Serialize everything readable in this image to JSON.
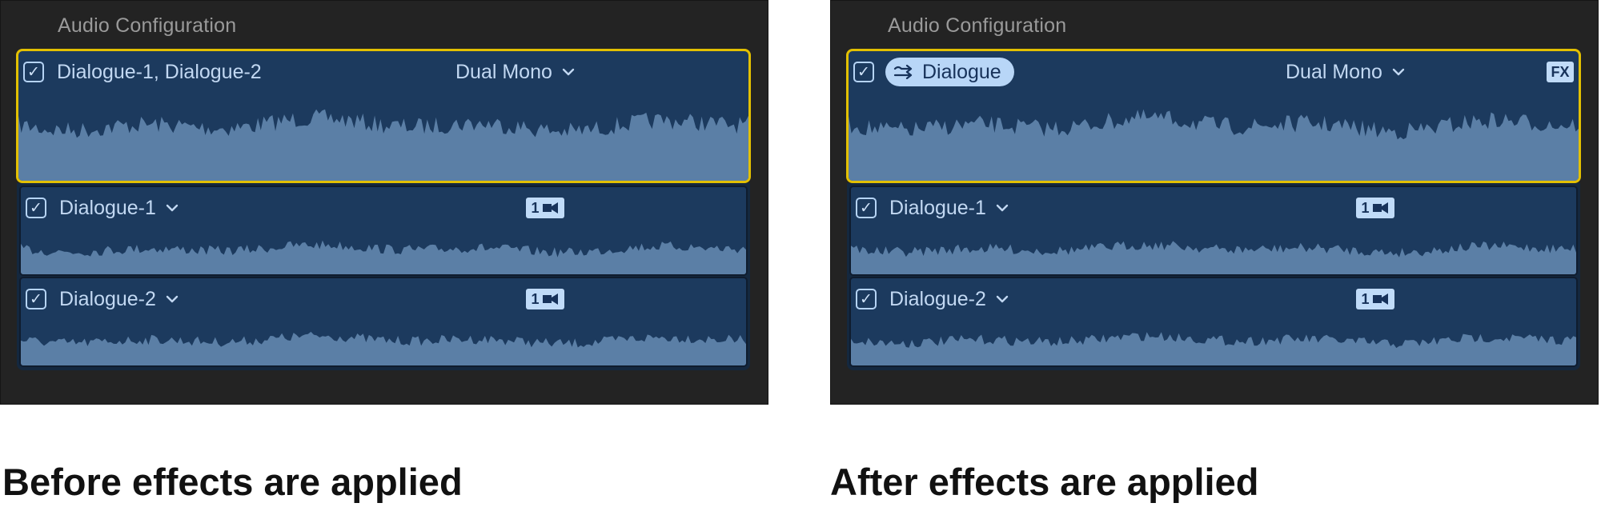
{
  "before": {
    "panel_title": "Audio Configuration",
    "group": {
      "checked": true,
      "name": "Dialogue-1, Dialogue-2",
      "config": "Dual Mono"
    },
    "lanes": [
      {
        "checked": true,
        "name": "Dialogue-1",
        "badge": "1"
      },
      {
        "checked": true,
        "name": "Dialogue-2",
        "badge": "1"
      }
    ],
    "caption": "Before effects are applied"
  },
  "after": {
    "panel_title": "Audio Configuration",
    "group": {
      "checked": true,
      "name": "Dialogue",
      "config": "Dual Mono",
      "fx_badge": "FX"
    },
    "lanes": [
      {
        "checked": true,
        "name": "Dialogue-1",
        "badge": "1"
      },
      {
        "checked": true,
        "name": "Dialogue-2",
        "badge": "1"
      }
    ],
    "caption": "After effects are applied"
  },
  "icons": {
    "checkbox": "checkmark-icon",
    "dropdown": "chevron-down-icon",
    "camera": "video-camera-icon",
    "compound": "compound-clip-icon"
  },
  "colors": {
    "selection_outline": "#e3c000",
    "clip_background": "#1c3a5e",
    "waveform_fill": "#5b7fa6",
    "panel_background": "#232323",
    "label_text": "#c2d8f2"
  }
}
